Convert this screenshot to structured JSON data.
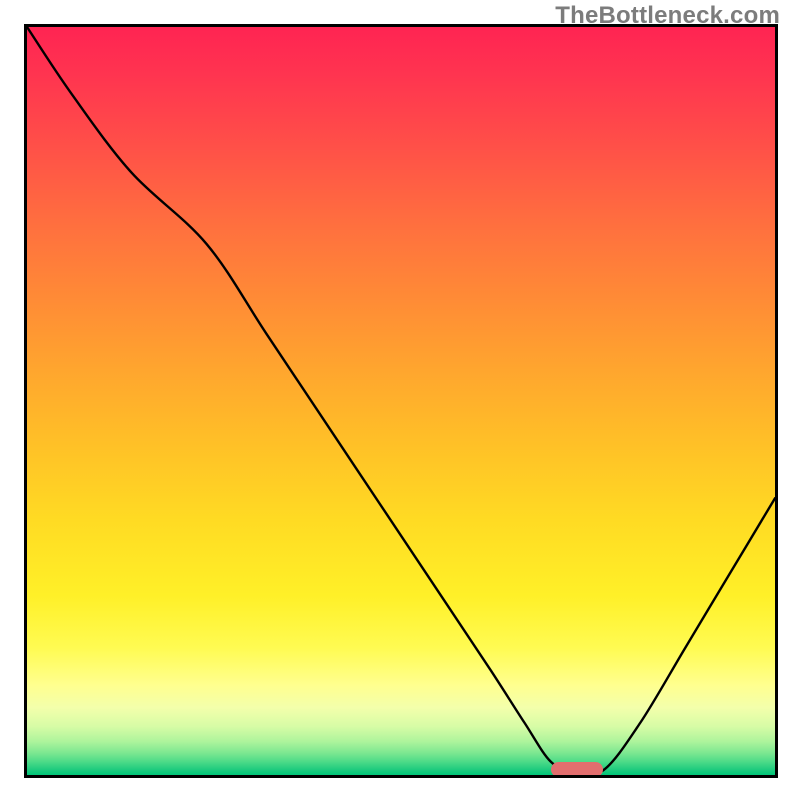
{
  "watermark": "TheBottleneck.com",
  "chart_data": {
    "type": "line",
    "title": "",
    "xlabel": "",
    "ylabel": "",
    "xlim": [
      0,
      100
    ],
    "ylim": [
      0,
      100
    ],
    "grid": false,
    "legend": false,
    "background": "red-to-green vertical gradient (bottleneck severity)",
    "note": "Axes unlabeled in source; x/y expressed as 0–100 percent of plot box. Curve estimated from pixels. Red pill marks optimum/no-bottleneck region (~x 70–77, y≈0).",
    "series": [
      {
        "name": "bottleneck-curve",
        "x": [
          0,
          6,
          14,
          24,
          32,
          40,
          48,
          56,
          62,
          66.5,
          70,
          73,
          77,
          82,
          88,
          94,
          100
        ],
        "values": [
          100,
          91,
          80.5,
          71,
          59,
          47,
          35,
          23,
          14,
          7,
          1.8,
          0.6,
          0.6,
          7,
          17,
          27,
          37
        ]
      }
    ],
    "optimum_marker": {
      "x_start": 70,
      "x_end": 77,
      "y": 0.7
    }
  }
}
